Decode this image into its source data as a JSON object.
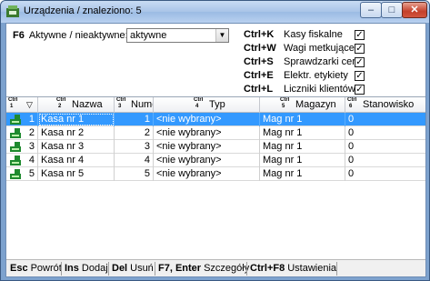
{
  "window": {
    "title": "Urządzenia / znaleziono: 5",
    "controls": {
      "minimize": "–",
      "maximize": "□",
      "close": "✕"
    }
  },
  "filter": {
    "key": "F6",
    "label": "Aktywne / nieaktywne:",
    "value": "aktywne"
  },
  "options": [
    {
      "shortcut": "Ctrl+K",
      "label": "Kasy fiskalne",
      "checked": "☑"
    },
    {
      "shortcut": "Ctrl+W",
      "label": "Wagi metkujące",
      "checked": "☑"
    },
    {
      "shortcut": "Ctrl+S",
      "label": "Sprawdzarki cen",
      "checked": "☑"
    },
    {
      "shortcut": "Ctrl+E",
      "label": "Elektr. etykiety",
      "checked": "☑"
    },
    {
      "shortcut": "Ctrl+L",
      "label": "Liczniki klientów",
      "checked": "☑"
    }
  ],
  "columns": [
    {
      "ctrl": "Ctrl",
      "num": "1",
      "title": ""
    },
    {
      "ctrl": "Ctrl",
      "num": "2",
      "title": "Nazwa"
    },
    {
      "ctrl": "Ctrl",
      "num": "3",
      "title": "Nume"
    },
    {
      "ctrl": "Ctrl",
      "num": "4",
      "title": "Typ"
    },
    {
      "ctrl": "Ctrl",
      "num": "5",
      "title": "Magazyn"
    },
    {
      "ctrl": "Ctrl",
      "num": "6",
      "title": "Stanowisko"
    }
  ],
  "rows": [
    {
      "id": "1",
      "name": "Kasa nr 1",
      "num": "1",
      "type": "<nie wybrany>",
      "store": "Mag nr 1",
      "station": "0"
    },
    {
      "id": "2",
      "name": "Kasa nr 2",
      "num": "2",
      "type": "<nie wybrany>",
      "store": "Mag nr 1",
      "station": "0"
    },
    {
      "id": "3",
      "name": "Kasa nr 3",
      "num": "3",
      "type": "<nie wybrany>",
      "store": "Mag nr 1",
      "station": "0"
    },
    {
      "id": "4",
      "name": "Kasa nr 4",
      "num": "4",
      "type": "<nie wybrany>",
      "store": "Mag nr 1",
      "station": "0"
    },
    {
      "id": "5",
      "name": "Kasa nr 5",
      "num": "5",
      "type": "<nie wybrany>",
      "store": "Mag nr 1",
      "station": "0"
    }
  ],
  "statusbar": [
    {
      "key": "Esc",
      "label": "Powrót"
    },
    {
      "key": "Ins",
      "label": "Dodaj"
    },
    {
      "key": "Del",
      "label": "Usuń"
    },
    {
      "key": "F7, Enter",
      "label": "Szczegóły"
    },
    {
      "key": "Ctrl+F8",
      "label": "Ustawienia"
    }
  ],
  "colors": {
    "selection": "#3399ff",
    "title_bar": "#a9c4e8",
    "icon_green": "#1e8a2e"
  }
}
